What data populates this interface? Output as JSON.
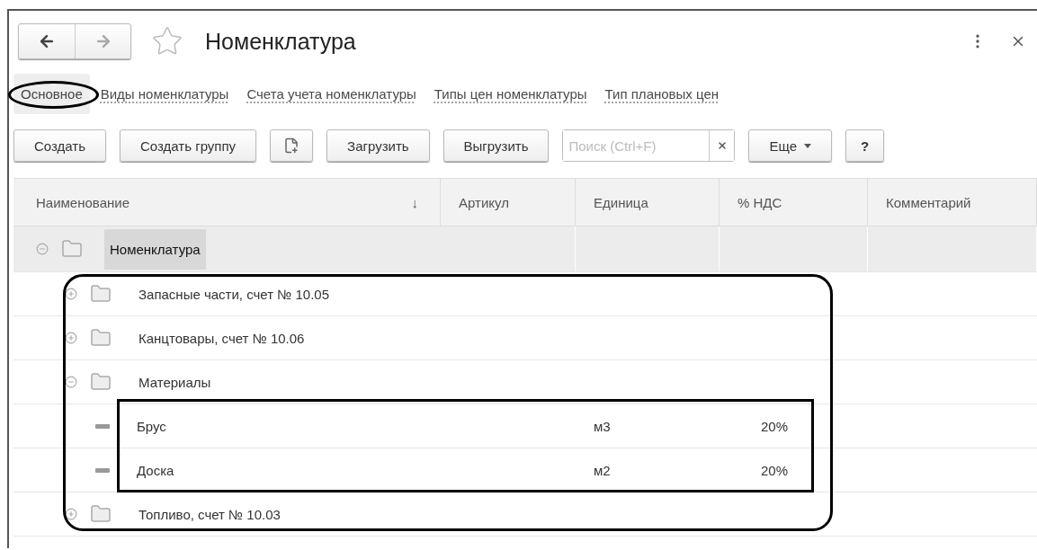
{
  "window": {
    "title": "Номенклатура"
  },
  "tabs": [
    {
      "label": "Основное",
      "selected": true
    },
    {
      "label": "Виды номенклатуры",
      "selected": false
    },
    {
      "label": "Счета учета номенклатуры",
      "selected": false
    },
    {
      "label": "Типы цен номенклатуры",
      "selected": false
    },
    {
      "label": "Тип плановых цен",
      "selected": false
    }
  ],
  "toolbar": {
    "create": "Создать",
    "create_group": "Создать группу",
    "load": "Загрузить",
    "unload": "Выгрузить",
    "search_placeholder": "Поиск (Ctrl+F)",
    "more": "Еще",
    "help": "?"
  },
  "table": {
    "columns": [
      {
        "label": "Наименование",
        "sort": "↓"
      },
      {
        "label": "Артикул"
      },
      {
        "label": "Единица"
      },
      {
        "label": "% НДС"
      },
      {
        "label": "Комментарий"
      }
    ],
    "rows": [
      {
        "kind": "folder",
        "name": "Номенклатура",
        "expanded": true,
        "selected": true,
        "children": [
          {
            "kind": "folder",
            "name": "Запасные части, счет № 10.05",
            "expanded": false,
            "selected": false
          },
          {
            "kind": "folder",
            "name": "Канцтовары, счет № 10.06",
            "expanded": false,
            "selected": false
          },
          {
            "kind": "folder",
            "name": "Материалы",
            "expanded": true,
            "selected": false,
            "children": [
              {
                "kind": "item",
                "name": "Брус",
                "unit": "м3",
                "vat": "20%",
                "selected": false
              },
              {
                "kind": "item",
                "name": "Доска",
                "unit": "м2",
                "vat": "20%",
                "selected": false
              }
            ]
          },
          {
            "kind": "folder",
            "name": "Топливо, счет № 10.03",
            "expanded": false,
            "selected": false
          }
        ]
      }
    ]
  },
  "annotations": [
    {
      "kind": "ellipse"
    },
    {
      "kind": "rounded_frame"
    },
    {
      "kind": "frame"
    }
  ]
}
